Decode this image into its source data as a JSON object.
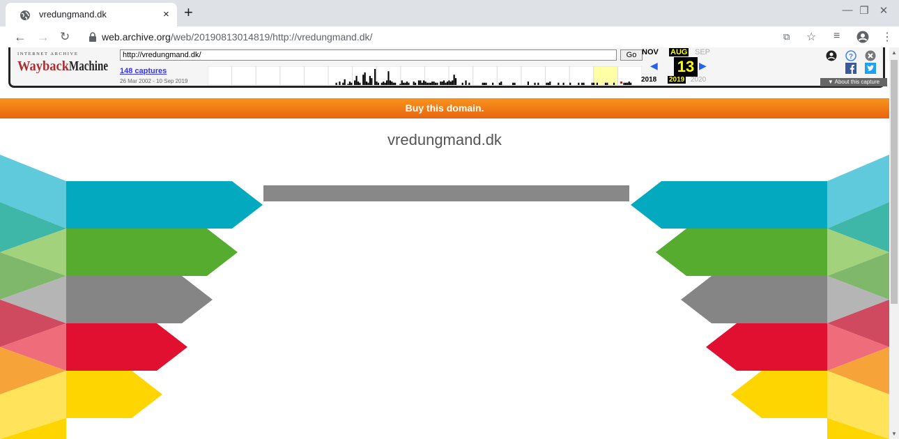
{
  "browser": {
    "tab_title": "vredungmand.dk",
    "tab_close": "×",
    "new_tab": "+",
    "url_host": "web.archive.org",
    "url_rest": "/web/20190813014819/http://vredungmand.dk/",
    "window_controls": {
      "minimize": "—",
      "restore": "❐",
      "close": "✕"
    }
  },
  "wayback": {
    "logo_small": "INTERNET ARCHIVE",
    "logo": "WaybackMachine",
    "url_value": "http://vredungmand.dk/",
    "go_label": "Go",
    "captures": "148 captures",
    "date_range": "26 Mar 2002 - 10 Sep 2019",
    "prev_month": "NOV",
    "current_month": "AUG",
    "next_month": "SEP",
    "day": "13",
    "prev_year": "2018",
    "current_year": "2019",
    "next_year": "2020",
    "about_label": "▼ About this capture",
    "capture_counts": [
      0,
      0,
      0,
      0,
      0,
      0,
      0,
      0,
      0,
      0,
      0,
      0,
      0,
      0,
      0,
      0,
      0,
      0,
      0,
      0,
      0,
      0,
      0,
      0,
      0,
      0,
      0,
      0,
      0,
      0,
      0,
      0,
      0,
      0,
      0,
      0,
      0,
      0,
      0,
      0,
      0,
      0,
      0,
      0,
      0,
      0,
      0,
      0,
      0,
      0,
      0,
      0,
      0,
      0,
      0,
      0,
      0,
      0,
      0,
      0,
      0,
      0,
      0,
      0,
      0,
      0,
      0,
      0,
      0,
      0,
      0,
      0,
      0,
      0,
      0,
      0,
      2,
      0,
      3,
      0,
      2,
      5,
      0,
      1,
      3,
      2,
      0,
      4,
      8,
      3,
      2,
      0,
      9,
      11,
      3,
      2,
      8,
      6,
      0,
      14,
      3,
      2,
      0,
      2,
      3,
      2,
      4,
      12,
      4,
      3,
      2,
      2,
      0,
      0,
      1,
      4,
      2,
      2,
      3,
      2,
      0,
      0,
      3,
      2,
      0,
      4,
      4,
      2,
      4,
      3,
      2,
      2,
      2,
      3,
      3,
      2,
      2,
      0,
      3,
      3,
      4,
      2,
      3,
      4,
      3,
      4,
      9,
      6,
      0,
      0,
      0,
      2,
      0,
      4,
      0,
      2,
      0,
      0,
      0,
      0,
      0,
      0,
      0,
      2,
      2,
      2,
      0,
      0,
      0,
      2,
      0,
      0,
      0,
      2,
      3,
      0,
      0,
      0,
      0,
      0,
      0,
      2,
      2,
      0,
      0,
      0,
      0,
      0,
      0,
      0,
      3,
      0,
      0,
      0,
      2,
      0,
      2,
      0,
      0,
      0,
      0,
      2,
      2,
      3,
      0,
      0,
      0,
      0,
      2,
      0,
      0,
      2,
      0,
      0,
      0,
      2,
      0,
      0,
      0,
      0,
      2,
      0,
      2,
      2,
      0,
      0,
      0,
      0,
      2,
      2,
      0,
      2,
      0,
      0,
      0,
      0,
      2,
      2,
      0,
      0,
      0,
      2,
      0,
      0,
      0,
      0,
      0,
      2,
      2,
      2,
      3,
      2,
      0,
      0,
      0,
      0,
      0,
      0
    ]
  },
  "page": {
    "banner": "Buy this domain.",
    "site_title": "vredungmand.dk"
  },
  "colors": {
    "teal": "#03aabf",
    "green": "#56ac2e",
    "gray": "#858585",
    "red": "#e11030",
    "yellow": "#ffd500",
    "banner": "#f07f17"
  }
}
